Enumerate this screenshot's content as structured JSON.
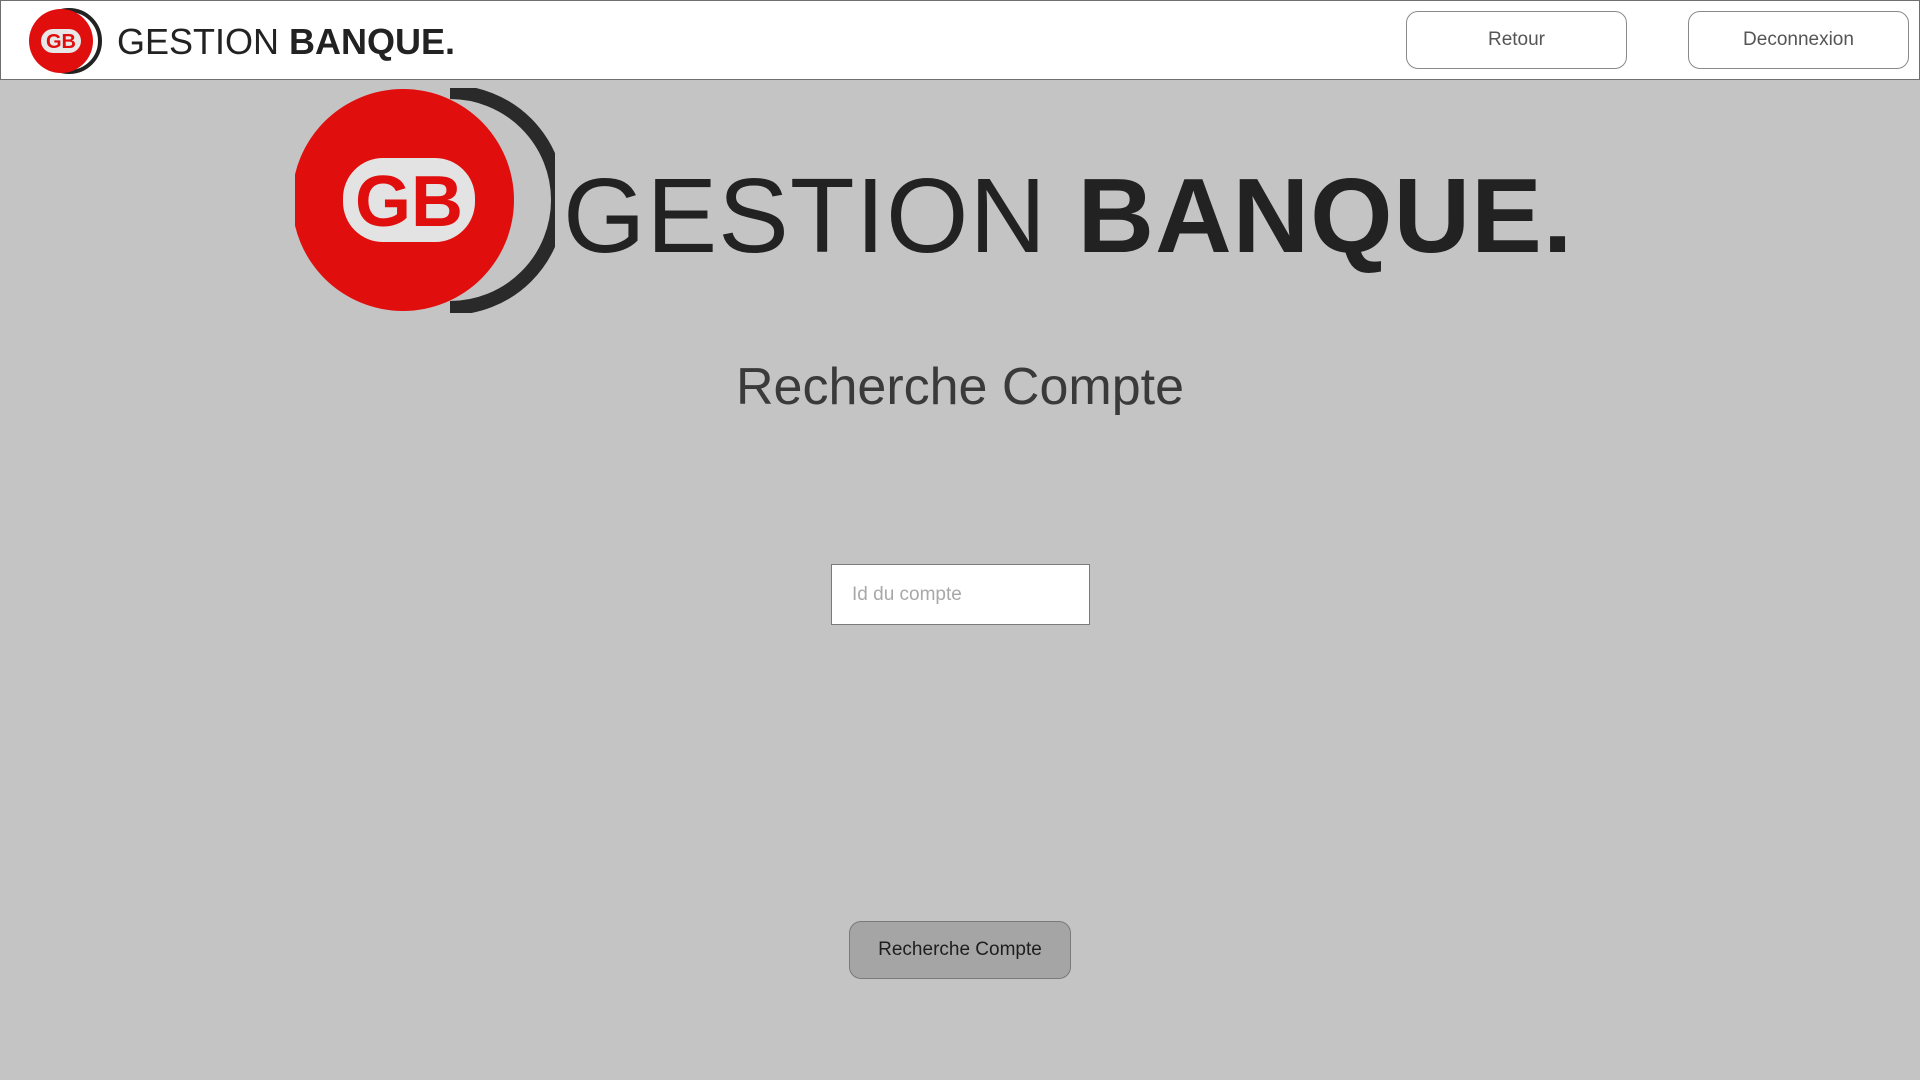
{
  "header": {
    "brand_light": "GESTION ",
    "brand_bold": "BANQUE.",
    "logo_initials": "GB",
    "back_label": "Retour",
    "logout_label": "Deconnexion"
  },
  "hero": {
    "brand_light": "GESTION ",
    "brand_bold": "BANQUE.",
    "logo_initials": "GB"
  },
  "main": {
    "title": "Recherche Compte",
    "account_id_placeholder": "Id du compte",
    "account_id_value": "",
    "search_button_label": "Recherche Compte"
  },
  "colors": {
    "background": "#c4c4c4",
    "brand_red": "#e10e0e",
    "brand_dark": "#222222",
    "button_fill": "#a5a5a5"
  }
}
